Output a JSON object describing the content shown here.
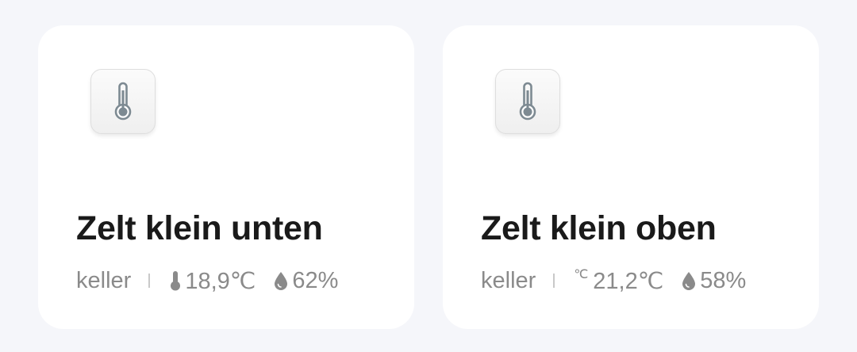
{
  "cards": [
    {
      "title": "Zelt klein unten",
      "room": "keller",
      "temperature": "18,9℃",
      "humidity": "62%",
      "device_icon": "thermometer-icon",
      "temp_icon": "thermometer-icon",
      "humidity_icon": "water-drop-icon"
    },
    {
      "title": "Zelt klein oben",
      "room": "keller",
      "temperature_unit_symbol": "℃",
      "temperature": "21,2℃",
      "humidity": "58%",
      "device_icon": "thermometer-icon",
      "temp_icon": "celsius-icon",
      "humidity_icon": "water-drop-icon"
    }
  ],
  "colors": {
    "background": "#f5f6fa",
    "card": "#ffffff",
    "title": "#1a1a1a",
    "meta_text": "#8a8a8a",
    "icon_gray": "#7d8a92"
  }
}
